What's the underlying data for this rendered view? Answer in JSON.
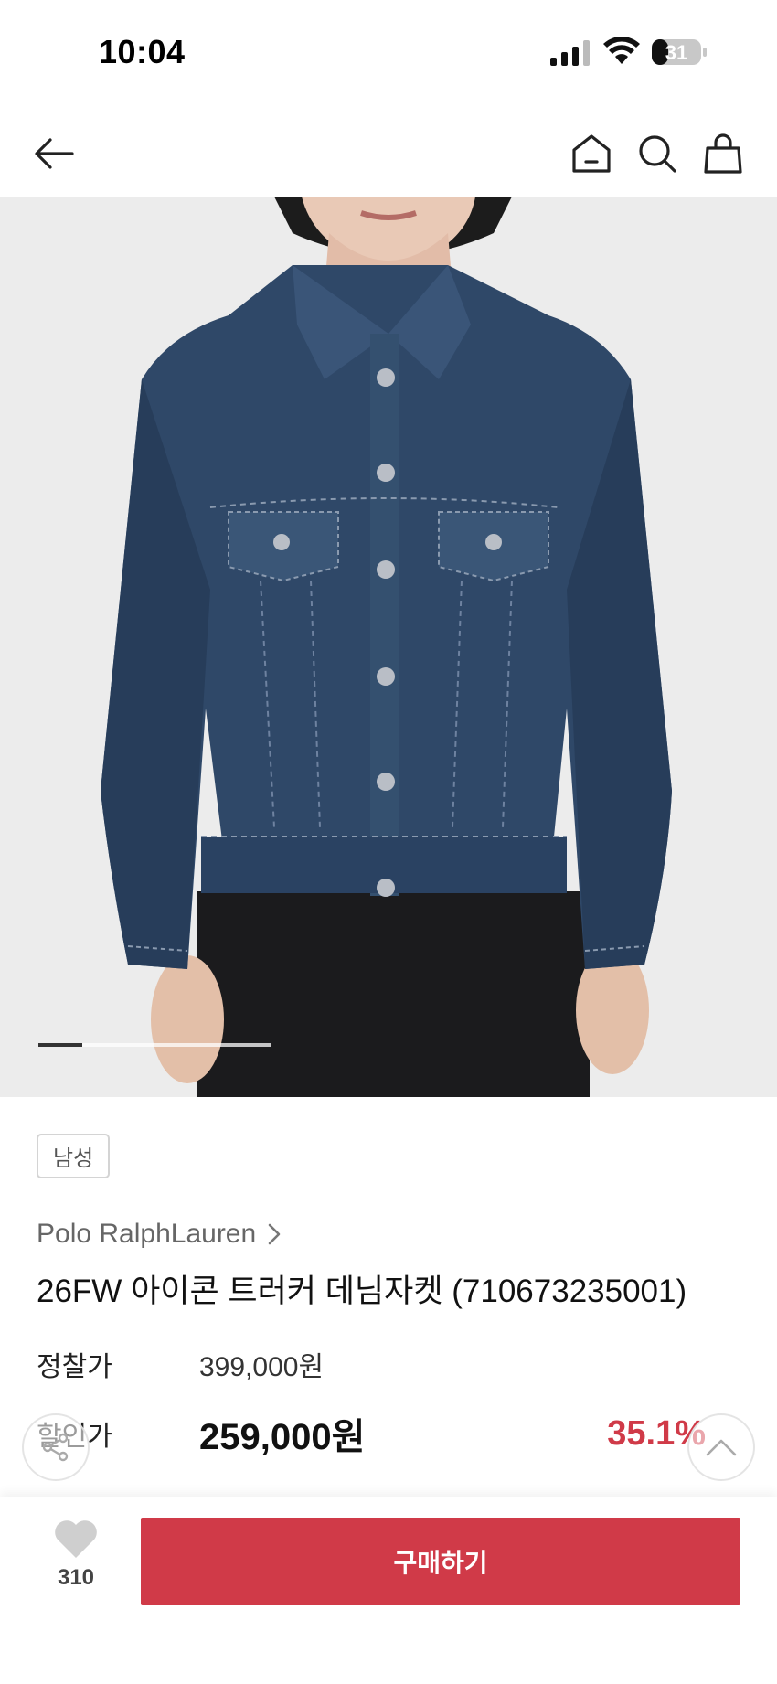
{
  "status_bar": {
    "time": "10:04",
    "battery_level": "31"
  },
  "nav": {
    "back_icon": "arrow-left-icon",
    "home_icon": "home-icon",
    "search_icon": "search-icon",
    "cart_icon": "shopping-bag-icon"
  },
  "product": {
    "image_description_icon": "denim-jacket-photo",
    "carousel_progress": 0.19,
    "gender_badge": "남성",
    "brand": "Polo RalphLauren",
    "title": "26FW 아이콘 트러커 데님자켓 (710673235001)",
    "list_price_label": "정찰가",
    "list_price": "399,000원",
    "sale_price_label": "할인가",
    "sale_price": "259,000원",
    "discount_rate": "35.1%"
  },
  "bottom_bar": {
    "like_count": "310",
    "buy_label": "구매하기"
  },
  "colors": {
    "accent": "#d03a48",
    "text_muted": "#666666",
    "heart": "#cfcfcf"
  }
}
